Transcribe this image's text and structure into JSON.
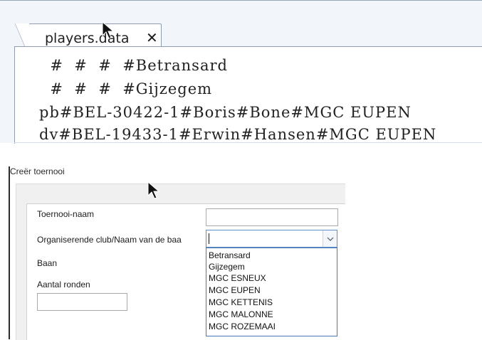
{
  "editor": {
    "tab": {
      "label": "players.data",
      "close": "✕"
    },
    "lines": [
      "  #  #  #  #Betransard",
      "  #  #  #  #Gijzegem",
      "pb#BEL-30422-1#Boris#Bone#MGC EUPEN",
      "dv#BEL-19433-1#Erwin#Hansen#MGC EUPEN"
    ]
  },
  "dialog": {
    "title": "Creër toernooi",
    "fields": {
      "tournament_name_label": "Toernooi-naam",
      "organising_club_label": "Organiserende club/Naam van de baa",
      "course_label": "Baan",
      "rounds_label": "Aantal ronden"
    },
    "club_options": [
      "Betransard",
      "Gijzegem",
      "MGC ESNEUX",
      "MGC EUPEN",
      "MGC KETTENIS",
      "MGC MALONNE",
      "MGC ROZEMAAI"
    ]
  },
  "icons": {
    "cursor": "mouse-pointer-icon",
    "dropdown": "chevron-down-icon",
    "close": "close-icon"
  }
}
